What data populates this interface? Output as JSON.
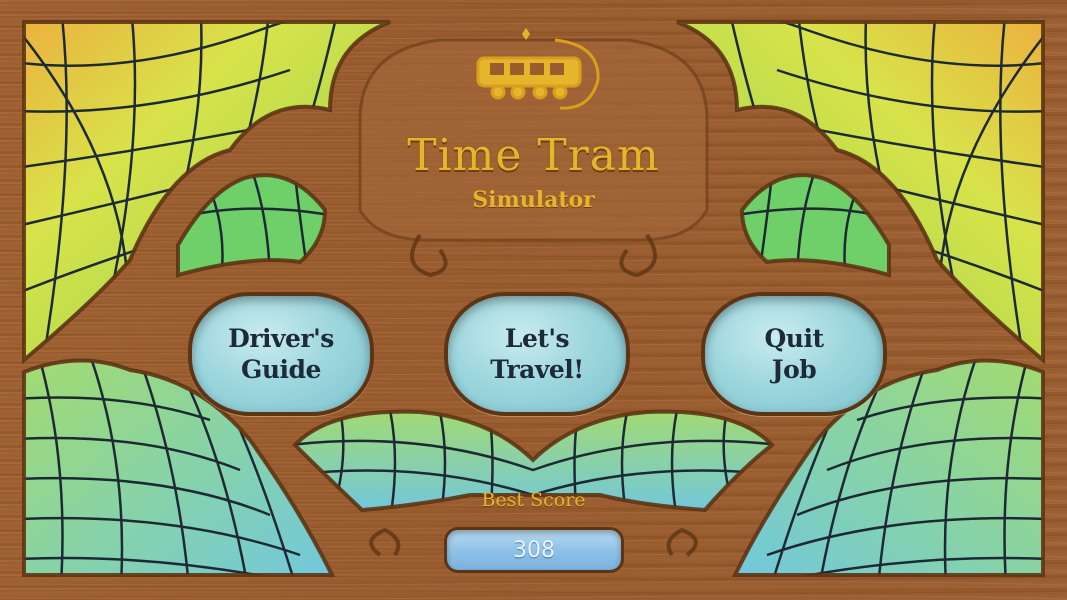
{
  "game": {
    "title": "Time Tram",
    "subtitle": "Simulator",
    "logo_icon": "tram-icon"
  },
  "menu": {
    "buttons": [
      {
        "line1": "Driver's",
        "line2": "Guide"
      },
      {
        "line1": "Let's",
        "line2": "Travel!"
      },
      {
        "line1": "Quit",
        "line2": "Job"
      }
    ]
  },
  "score": {
    "label": "Best Score",
    "value": "308"
  },
  "colors": {
    "wood": "#9a5d2c",
    "wood_dark": "#5e3514",
    "gold": "#e7b52c",
    "glass_green": "#8fd35a",
    "glass_blue": "#7cc8e0",
    "glass_orange": "#f0a83c",
    "glass_yellow": "#d8e34a",
    "leading": "#1d2a33"
  }
}
